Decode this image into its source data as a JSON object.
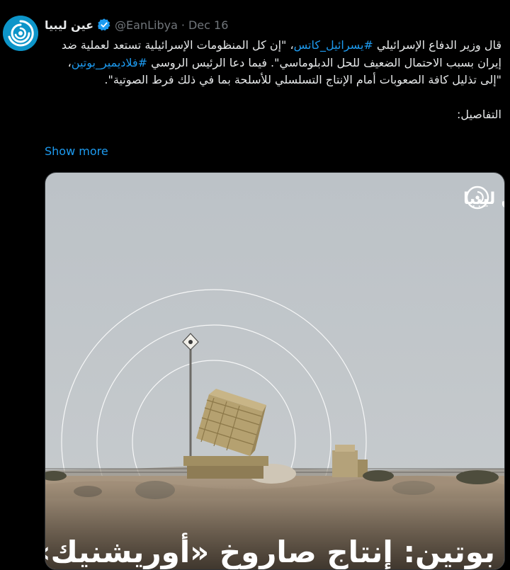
{
  "post": {
    "author": {
      "name": "عين ليبيا",
      "handle": "@EanLibya",
      "verified": true
    },
    "separator": "·",
    "date": "Dec 16",
    "text": {
      "part1": "قال وزير الدفاع الإسرائيلي ",
      "hashtag1": "#يسرائيل_كاتس",
      "part2": "، \"إن كل المنظومات الإسرائيلية تستعد لعملية ضد إيران بسبب الاحتمال الضعيف للحل الدبلوماسي\". فيما دعا الرئيس الروسي ",
      "hashtag2": "#فلاديمير_بوتين",
      "part3": "، \"إلى تذليل كافة الصعوبات أمام الإنتاج التسلسلي للأسلحة بما في ذلك فرط الصوتية\".",
      "details": "التفاصيل:"
    },
    "show_more": "Show more",
    "media": {
      "watermark": "عين ليبيا",
      "caption": "بوتين: إنتاج صاروخ «أوريشنيك» سيبدأ"
    }
  },
  "colors": {
    "background": "#000000",
    "text": "#e7e9ea",
    "muted": "#71767b",
    "link": "#1d9bf0",
    "avatar": "#0d95c9",
    "sky": "#bfc4c8",
    "ground": "#a18e78",
    "launcher": "#b39f6e"
  },
  "icons": {
    "avatar": "ean-libya-logo",
    "verified": "verified-badge-icon"
  }
}
